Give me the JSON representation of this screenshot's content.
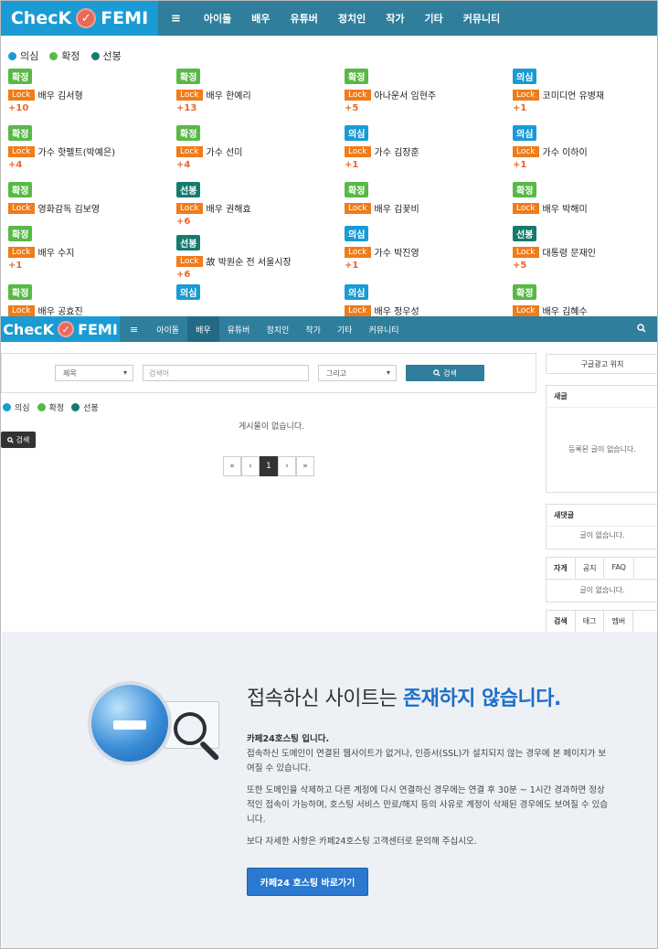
{
  "brand": {
    "left": "ChecK",
    "right": "FEMI",
    "check_glyph": "✓"
  },
  "nav": {
    "menu_icon": "≡",
    "items": [
      "아이돌",
      "배우",
      "유튜버",
      "정치인",
      "작가",
      "기타",
      "커뮤니티"
    ],
    "active_index_lower": 1
  },
  "legend": [
    {
      "label": "의심",
      "color": "#1a9bd4"
    },
    {
      "label": "확정",
      "color": "#58b947"
    },
    {
      "label": "선봉",
      "color": "#167a6e"
    }
  ],
  "lock_label": "Lock",
  "cards": [
    {
      "status": "확정",
      "name": "배우 김서형",
      "count": "+10"
    },
    {
      "status": "확정",
      "name": "배우 한예리",
      "count": "+13"
    },
    {
      "status": "확정",
      "name": "아나운서 임현주",
      "count": "+5"
    },
    {
      "status": "의심",
      "name": "코미디언 유병재",
      "count": "+1"
    },
    {
      "status": "확정",
      "name": "가수 핫펠트(박예은)",
      "count": "+4"
    },
    {
      "status": "확정",
      "name": "가수 선미",
      "count": "+4"
    },
    {
      "status": "의심",
      "name": "가수 김장훈",
      "count": "+1"
    },
    {
      "status": "의심",
      "name": "가수 이하이",
      "count": "+1"
    },
    {
      "status": "확정",
      "name": "영화감독 김보영",
      "count": ""
    },
    {
      "status": "선봉",
      "name": "배우 권해효",
      "count": "+6"
    },
    {
      "status": "확정",
      "name": "배우 김꽃비",
      "count": ""
    },
    {
      "status": "확정",
      "name": "배우 박해미",
      "count": ""
    },
    {
      "status": "확정",
      "name": "배우 수지",
      "count": "+1"
    },
    {
      "status": "선봉",
      "name": "故 박원순 전 서울시장",
      "count": "+6"
    },
    {
      "status": "의심",
      "name": "가수 박진영",
      "count": "+1"
    },
    {
      "status": "선봉",
      "name": "대통령 문재인",
      "count": "+5"
    },
    {
      "status": "확정",
      "name": "배우 공효진",
      "count": ""
    },
    {
      "status": "의심",
      "name": "",
      "count": ""
    },
    {
      "status": "의심",
      "name": "배우 정우성",
      "count": ""
    },
    {
      "status": "확정",
      "name": "배우 김혜수",
      "count": ""
    }
  ],
  "search": {
    "field_select": "제목",
    "placeholder": "검색어",
    "op_select": "그리고",
    "button": "검색",
    "search_icon": "🔍"
  },
  "board": {
    "empty": "게시물이 없습니다.",
    "small_button": "검색"
  },
  "pager": [
    "«",
    "‹",
    "1",
    "›",
    "»"
  ],
  "sidebar": {
    "ad": "구글광고 위치",
    "new_posts_title": "새글",
    "new_posts_empty": "등록된 글이 없습니다.",
    "new_comments_title": "새댓글",
    "new_comments_empty": "글이 없습니다.",
    "tabs1": [
      "자게",
      "공지",
      "FAQ"
    ],
    "tabs1_empty": "글이 없습니다.",
    "tabs2": [
      "검색",
      "태그",
      "멤버"
    ]
  },
  "notice": {
    "title_plain": "접속하신 사이트는 ",
    "title_highlight": "존재하지 않습니다.",
    "host": "카페24호스팅 입니다.",
    "p1": "접속하신 도메인이 연결된 웹사이트가 없거나, 인증서(SSL)가 설치되지 않는 경우에 본 페이지가 보여질 수 있습니다.",
    "p2": "또한 도메인을 삭제하고 다른 계정에 다시 연결하신 경우에는 연결 후 30분 ~ 1시간 경과하면 정상적인 접속이 가능하며, 호스팅 서비스 만료/해지 등의 사유로 계정이 삭제된 경우에도 보여질 수 있습니다.",
    "p3": "보다 자세한 사항은 카페24호스팅 고객센터로 문의해 주십시오.",
    "button": "카페24 호스팅 바로가기"
  }
}
